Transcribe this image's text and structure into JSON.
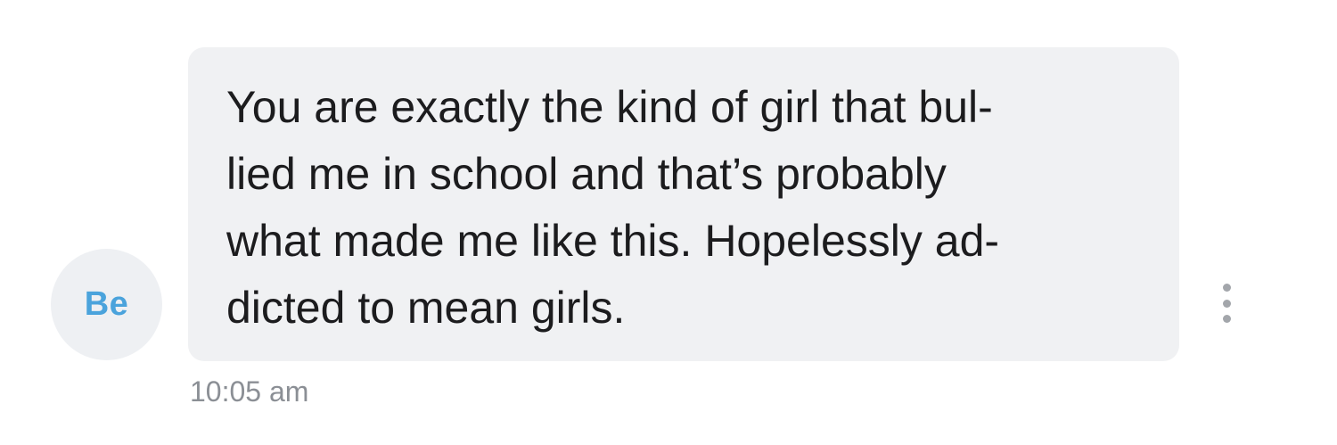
{
  "sender": {
    "initials": "Be",
    "initials_color": "#4aa3dc",
    "avatar_bg": "#eef0f3"
  },
  "message": {
    "lines": [
      "You are exactly the kind of girl that bul-",
      "lied me in school and that’s probably",
      "what made me like this. Hopelessly ad-",
      "dicted to mean girls."
    ],
    "bubble_color": "#f0f1f3",
    "timestamp": "10:05 am"
  },
  "actions": {
    "more_icon": "more-vertical-icon"
  }
}
